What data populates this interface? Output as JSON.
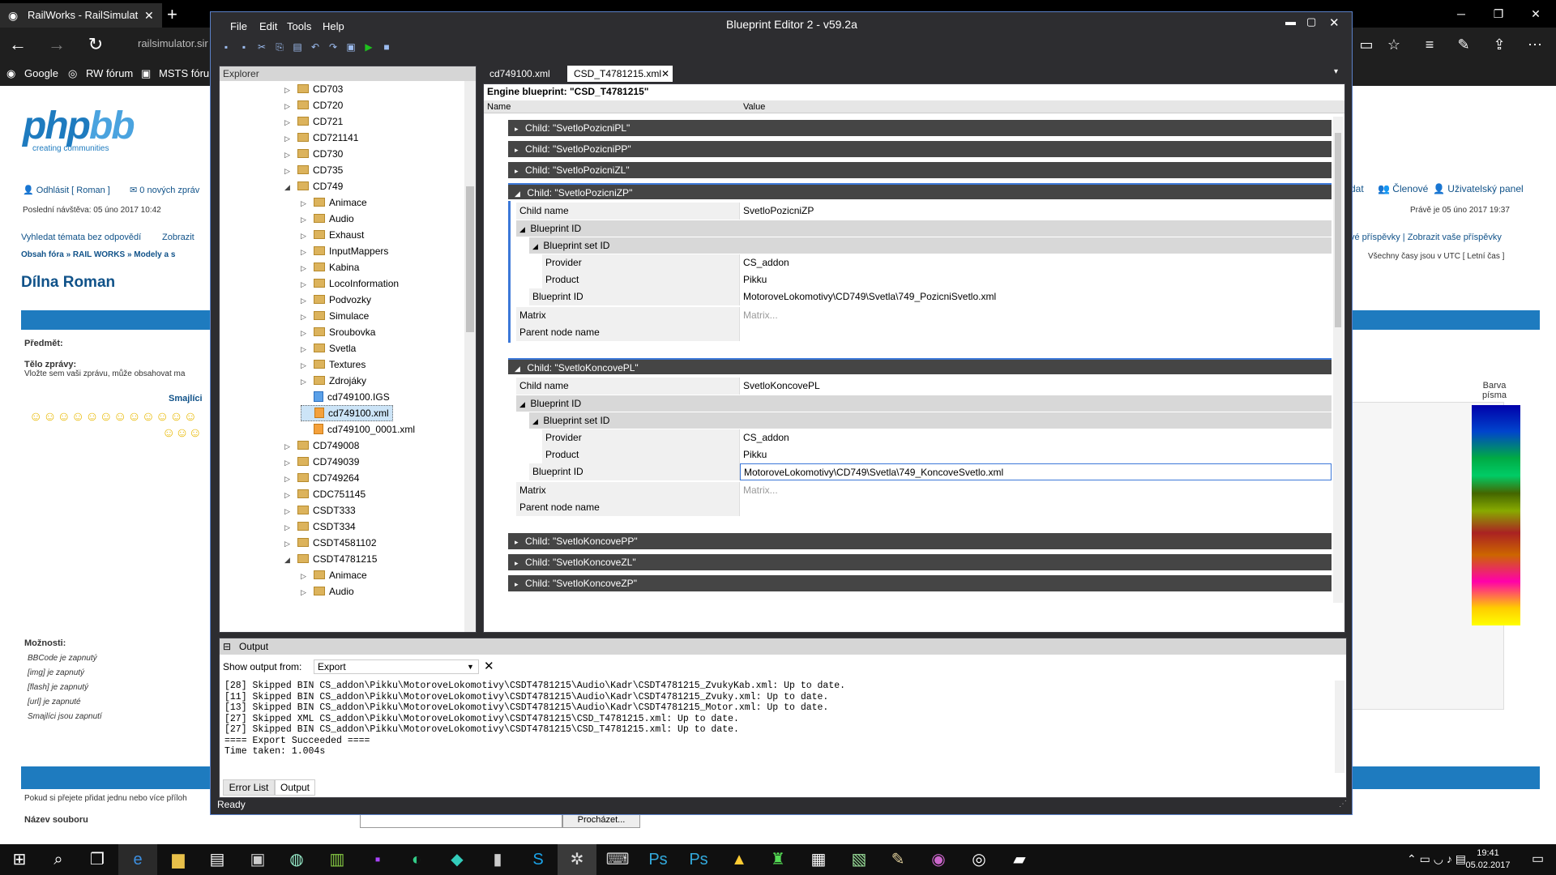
{
  "browser": {
    "tab_title": "RailWorks - RailSimulat",
    "address": "railsimulator.sir",
    "favorites": [
      "Google",
      "RW fórum",
      "MSTS fórum"
    ]
  },
  "forum": {
    "logout": "Odhlásit [ Roman ]",
    "new_messages": "0 nových zpráv",
    "last_visit": "Poslední návštěva: 05 úno 2017 10:42",
    "unanswered": "Vyhledat témata bez odpovědí",
    "show": "Zobrazit",
    "breadcrumb": "Obsah fóra » RAIL WORKS » Modely a s",
    "topic_title": "Dílna Roman",
    "subject_label": "Předmět:",
    "body_label": "Tělo zprávy:",
    "body_hint": "Vložte sem vaši zprávu, může obsahovat ma",
    "smilies": "Smajlíci",
    "right_links": [
      "dat",
      "Členové",
      "Uživatelský panel"
    ],
    "now": "Právě je 05 úno 2017 19:37",
    "right_links2": "vé příspěvky | Zobrazit vaše příspěvky",
    "timezone": "Všechny časy jsou v UTC [ Letní čas ]",
    "color_label": "Barva písma",
    "options_label": "Možnosti:",
    "options": [
      "BBCode je zapnutý",
      "[img] je zapnutý",
      "[flash] je zapnutý",
      "[url] je zapnuté",
      "Smajlíci jsou zapnutí"
    ],
    "attach_hint": "Pokud si přejete přidat jednu nebo více příloh",
    "filename_label": "Název souboru",
    "browse": "Procházet..."
  },
  "editor": {
    "title": "Blueprint Editor 2 - v59.2a",
    "menu": [
      "File",
      "Edit",
      "Tools",
      "Help"
    ],
    "explorer_title": "Explorer",
    "tree": [
      {
        "label": "CD703",
        "type": "folder",
        "level": 0
      },
      {
        "label": "CD720",
        "type": "folder",
        "level": 0
      },
      {
        "label": "CD721",
        "type": "folder",
        "level": 0
      },
      {
        "label": "CD721141",
        "type": "folder",
        "level": 0
      },
      {
        "label": "CD730",
        "type": "folder",
        "level": 0
      },
      {
        "label": "CD735",
        "type": "folder",
        "level": 0
      },
      {
        "label": "CD749",
        "type": "folder",
        "level": 0,
        "open": true
      },
      {
        "label": "Animace",
        "type": "folder",
        "level": 1
      },
      {
        "label": "Audio",
        "type": "folder",
        "level": 1
      },
      {
        "label": "Exhaust",
        "type": "folder",
        "level": 1
      },
      {
        "label": "InputMappers",
        "type": "folder",
        "level": 1
      },
      {
        "label": "Kabina",
        "type": "folder",
        "level": 1
      },
      {
        "label": "LocoInformation",
        "type": "folder",
        "level": 1
      },
      {
        "label": "Podvozky",
        "type": "folder",
        "level": 1
      },
      {
        "label": "Simulace",
        "type": "folder",
        "level": 1
      },
      {
        "label": "Sroubovka",
        "type": "folder",
        "level": 1
      },
      {
        "label": "Svetla",
        "type": "folder",
        "level": 1
      },
      {
        "label": "Textures",
        "type": "folder",
        "level": 1
      },
      {
        "label": "Zdrojáky",
        "type": "folder",
        "level": 1
      },
      {
        "label": "cd749100.IGS",
        "type": "igs",
        "level": 1
      },
      {
        "label": "cd749100.xml",
        "type": "xml",
        "level": 1,
        "selected": true
      },
      {
        "label": "cd749100_0001.xml",
        "type": "xml",
        "level": 1
      },
      {
        "label": "CD749008",
        "type": "folder",
        "level": 0
      },
      {
        "label": "CD749039",
        "type": "folder",
        "level": 0
      },
      {
        "label": "CD749264",
        "type": "folder",
        "level": 0
      },
      {
        "label": "CDC751145",
        "type": "folder",
        "level": 0
      },
      {
        "label": "CSDT333",
        "type": "folder",
        "level": 0
      },
      {
        "label": "CSDT334",
        "type": "folder",
        "level": 0
      },
      {
        "label": "CSDT4581102",
        "type": "folder",
        "level": 0
      },
      {
        "label": "CSDT4781215",
        "type": "folder",
        "level": 0,
        "open": true
      },
      {
        "label": "Animace",
        "type": "folder",
        "level": 1
      },
      {
        "label": "Audio",
        "type": "folder",
        "level": 1
      }
    ],
    "doc_tabs": [
      "cd749100.xml",
      "CSD_T4781215.xml"
    ],
    "doc_title": "Engine blueprint: \"CSD_T4781215\"",
    "col_name": "Name",
    "col_value": "Value",
    "children": [
      "Child: \"SvetloPozicniPL\"",
      "Child: \"SvetloPozicniPP\"",
      "Child: \"SvetloPozicniZL\"",
      "Child: \"SvetloPozicniZP\"",
      "Child: \"SvetloKoncovePL\"",
      "Child: \"SvetloKoncovePP\"",
      "Child: \"SvetloKoncoveZL\"",
      "Child: \"SvetloKoncoveZP\""
    ],
    "block1": {
      "child_name_label": "Child name",
      "child_name": "SvetloPozicniZP",
      "bp_id": "Blueprint ID",
      "bp_set_id": "Blueprint set ID",
      "provider_label": "Provider",
      "provider": "CS_addon",
      "product_label": "Product",
      "product": "Pikku",
      "bp_id_label": "Blueprint ID",
      "bp_id_value": "MotoroveLokomotivy\\CD749\\Svetla\\749_PozicniSvetlo.xml",
      "matrix_label": "Matrix",
      "matrix_ph": "Matrix...",
      "parent_label": "Parent node name"
    },
    "block2": {
      "child_name_label": "Child name",
      "child_name": "SvetloKoncovePL",
      "bp_id": "Blueprint ID",
      "bp_set_id": "Blueprint set ID",
      "provider_label": "Provider",
      "provider": "CS_addon",
      "product_label": "Product",
      "product": "Pikku",
      "bp_id_label": "Blueprint ID",
      "bp_id_value": "MotoroveLokomotivy\\CD749\\Svetla\\749_KoncoveSvetlo.xml",
      "matrix_label": "Matrix",
      "matrix_ph": "Matrix...",
      "parent_label": "Parent node name"
    },
    "output_title": "Output",
    "show_output_from": "Show output from:",
    "output_source": "Export",
    "log": "[28] Skipped BIN CS_addon\\Pikku\\MotoroveLokomotivy\\CSDT4781215\\Audio\\Kadr\\CSDT4781215_ZvukyKab.xml: Up to date.\n[11] Skipped BIN CS_addon\\Pikku\\MotoroveLokomotivy\\CSDT4781215\\Audio\\Kadr\\CSDT4781215_Zvuky.xml: Up to date.\n[13] Skipped BIN CS_addon\\Pikku\\MotoroveLokomotivy\\CSDT4781215\\Audio\\Kadr\\CSDT4781215_Motor.xml: Up to date.\n[27] Skipped XML CS_addon\\Pikku\\MotoroveLokomotivy\\CSDT4781215\\CSD_T4781215.xml: Up to date.\n[27] Skipped BIN CS_addon\\Pikku\\MotoroveLokomotivy\\CSDT4781215\\CSD_T4781215.xml: Up to date.\n==== Export Succeeded ====\nTime taken: 1.004s",
    "bottom_tabs": [
      "Error List",
      "Output"
    ],
    "status": "Ready"
  },
  "taskbar": {
    "time": "19:41",
    "date": "05.02.2017"
  }
}
